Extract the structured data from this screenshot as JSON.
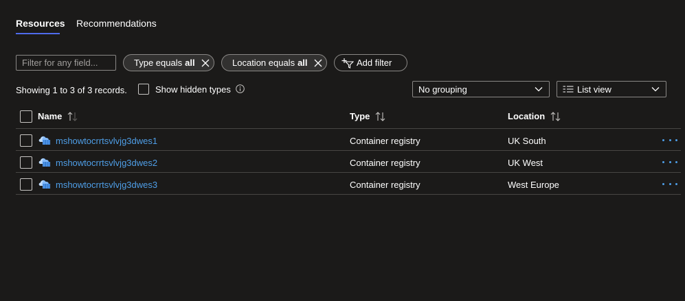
{
  "tabs": [
    {
      "label": "Resources",
      "active": true
    },
    {
      "label": "Recommendations",
      "active": false
    }
  ],
  "filter": {
    "placeholder": "Filter for any field...",
    "value": ""
  },
  "pills": {
    "type": {
      "prefix": "Type equals",
      "value": "all"
    },
    "location": {
      "prefix": "Location equals",
      "value": "all"
    },
    "add": {
      "label": "Add filter"
    }
  },
  "records_text": "Showing 1 to 3 of 3 records.",
  "show_hidden": {
    "label": "Show hidden types",
    "checked": false
  },
  "grouping": {
    "selected": "No grouping"
  },
  "view": {
    "selected": "List view"
  },
  "table": {
    "headers": {
      "name": "Name",
      "type": "Type",
      "location": "Location"
    },
    "rows": [
      {
        "name": "mshowtocrrtsvlvjg3dwes1",
        "type": "Container registry",
        "location": "UK South"
      },
      {
        "name": "mshowtocrrtsvlvjg3dwes2",
        "type": "Container registry",
        "location": "UK West"
      },
      {
        "name": "mshowtocrrtsvlvjg3dwes3",
        "type": "Container registry",
        "location": "West Europe"
      }
    ]
  },
  "colors": {
    "background": "#1b1a19",
    "accent": "#4f6bed",
    "link": "#4f9fe8",
    "border": "#8a8886"
  },
  "icons": {
    "row": "container-registry-icon",
    "more": "more-icon",
    "sort": "sort-icon",
    "info": "info-icon",
    "close": "close-icon",
    "add_filter": "add-filter-icon",
    "chevron": "chevron-down-icon",
    "list_view": "list-view-icon"
  }
}
